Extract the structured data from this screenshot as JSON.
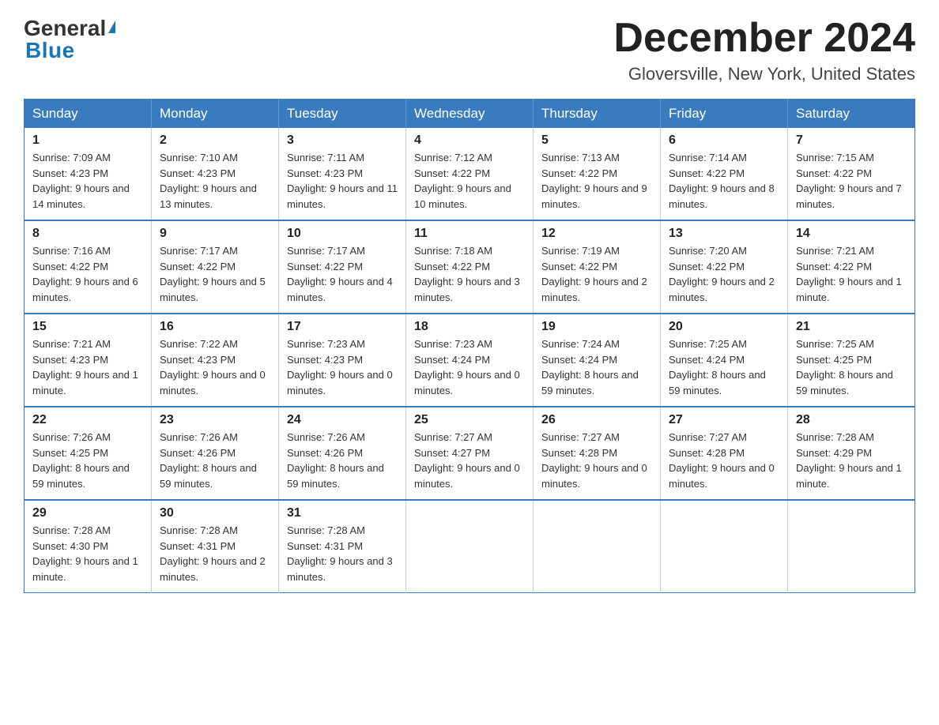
{
  "header": {
    "logo_top": "General",
    "logo_bottom": "Blue",
    "title": "December 2024",
    "subtitle": "Gloversville, New York, United States"
  },
  "days_of_week": [
    "Sunday",
    "Monday",
    "Tuesday",
    "Wednesday",
    "Thursday",
    "Friday",
    "Saturday"
  ],
  "weeks": [
    [
      {
        "num": "1",
        "sunrise": "7:09 AM",
        "sunset": "4:23 PM",
        "daylight": "9 hours and 14 minutes."
      },
      {
        "num": "2",
        "sunrise": "7:10 AM",
        "sunset": "4:23 PM",
        "daylight": "9 hours and 13 minutes."
      },
      {
        "num": "3",
        "sunrise": "7:11 AM",
        "sunset": "4:23 PM",
        "daylight": "9 hours and 11 minutes."
      },
      {
        "num": "4",
        "sunrise": "7:12 AM",
        "sunset": "4:22 PM",
        "daylight": "9 hours and 10 minutes."
      },
      {
        "num": "5",
        "sunrise": "7:13 AM",
        "sunset": "4:22 PM",
        "daylight": "9 hours and 9 minutes."
      },
      {
        "num": "6",
        "sunrise": "7:14 AM",
        "sunset": "4:22 PM",
        "daylight": "9 hours and 8 minutes."
      },
      {
        "num": "7",
        "sunrise": "7:15 AM",
        "sunset": "4:22 PM",
        "daylight": "9 hours and 7 minutes."
      }
    ],
    [
      {
        "num": "8",
        "sunrise": "7:16 AM",
        "sunset": "4:22 PM",
        "daylight": "9 hours and 6 minutes."
      },
      {
        "num": "9",
        "sunrise": "7:17 AM",
        "sunset": "4:22 PM",
        "daylight": "9 hours and 5 minutes."
      },
      {
        "num": "10",
        "sunrise": "7:17 AM",
        "sunset": "4:22 PM",
        "daylight": "9 hours and 4 minutes."
      },
      {
        "num": "11",
        "sunrise": "7:18 AM",
        "sunset": "4:22 PM",
        "daylight": "9 hours and 3 minutes."
      },
      {
        "num": "12",
        "sunrise": "7:19 AM",
        "sunset": "4:22 PM",
        "daylight": "9 hours and 2 minutes."
      },
      {
        "num": "13",
        "sunrise": "7:20 AM",
        "sunset": "4:22 PM",
        "daylight": "9 hours and 2 minutes."
      },
      {
        "num": "14",
        "sunrise": "7:21 AM",
        "sunset": "4:22 PM",
        "daylight": "9 hours and 1 minute."
      }
    ],
    [
      {
        "num": "15",
        "sunrise": "7:21 AM",
        "sunset": "4:23 PM",
        "daylight": "9 hours and 1 minute."
      },
      {
        "num": "16",
        "sunrise": "7:22 AM",
        "sunset": "4:23 PM",
        "daylight": "9 hours and 0 minutes."
      },
      {
        "num": "17",
        "sunrise": "7:23 AM",
        "sunset": "4:23 PM",
        "daylight": "9 hours and 0 minutes."
      },
      {
        "num": "18",
        "sunrise": "7:23 AM",
        "sunset": "4:24 PM",
        "daylight": "9 hours and 0 minutes."
      },
      {
        "num": "19",
        "sunrise": "7:24 AM",
        "sunset": "4:24 PM",
        "daylight": "8 hours and 59 minutes."
      },
      {
        "num": "20",
        "sunrise": "7:25 AM",
        "sunset": "4:24 PM",
        "daylight": "8 hours and 59 minutes."
      },
      {
        "num": "21",
        "sunrise": "7:25 AM",
        "sunset": "4:25 PM",
        "daylight": "8 hours and 59 minutes."
      }
    ],
    [
      {
        "num": "22",
        "sunrise": "7:26 AM",
        "sunset": "4:25 PM",
        "daylight": "8 hours and 59 minutes."
      },
      {
        "num": "23",
        "sunrise": "7:26 AM",
        "sunset": "4:26 PM",
        "daylight": "8 hours and 59 minutes."
      },
      {
        "num": "24",
        "sunrise": "7:26 AM",
        "sunset": "4:26 PM",
        "daylight": "8 hours and 59 minutes."
      },
      {
        "num": "25",
        "sunrise": "7:27 AM",
        "sunset": "4:27 PM",
        "daylight": "9 hours and 0 minutes."
      },
      {
        "num": "26",
        "sunrise": "7:27 AM",
        "sunset": "4:28 PM",
        "daylight": "9 hours and 0 minutes."
      },
      {
        "num": "27",
        "sunrise": "7:27 AM",
        "sunset": "4:28 PM",
        "daylight": "9 hours and 0 minutes."
      },
      {
        "num": "28",
        "sunrise": "7:28 AM",
        "sunset": "4:29 PM",
        "daylight": "9 hours and 1 minute."
      }
    ],
    [
      {
        "num": "29",
        "sunrise": "7:28 AM",
        "sunset": "4:30 PM",
        "daylight": "9 hours and 1 minute."
      },
      {
        "num": "30",
        "sunrise": "7:28 AM",
        "sunset": "4:31 PM",
        "daylight": "9 hours and 2 minutes."
      },
      {
        "num": "31",
        "sunrise": "7:28 AM",
        "sunset": "4:31 PM",
        "daylight": "9 hours and 3 minutes."
      },
      null,
      null,
      null,
      null
    ]
  ],
  "labels": {
    "sunrise": "Sunrise:",
    "sunset": "Sunset:",
    "daylight": "Daylight:"
  }
}
